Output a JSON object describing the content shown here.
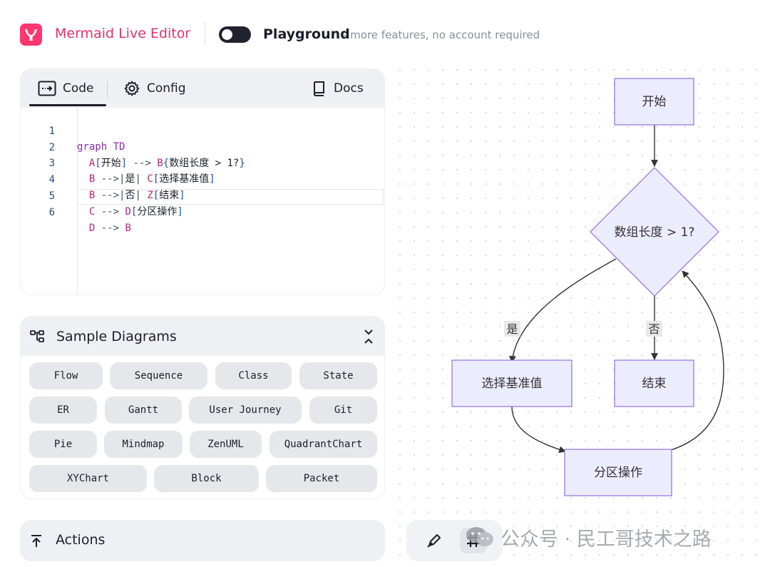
{
  "header": {
    "app_title": "Mermaid Live Editor",
    "mode_label": "Playground",
    "mode_subtitle": "- more features, no account required",
    "toggle_on": false
  },
  "editor": {
    "tabs": [
      {
        "label": "Code",
        "icon": "code-arrow-icon",
        "active": true
      },
      {
        "label": "Config",
        "icon": "gear-icon",
        "active": false
      }
    ],
    "docs_label": "Docs",
    "line_numbers": [
      "1",
      "2",
      "3",
      "4",
      "5",
      "6"
    ],
    "active_line": 6,
    "code": {
      "l1_kw": "graph",
      "l1_dir": "TD",
      "l2_a": "A",
      "l2_a_text": "开始",
      "l2_arrow": "-->",
      "l2_b": "B",
      "l2_b_text": "数组长度 > 1?",
      "l3_b": "B",
      "l3_arrow": "-->|",
      "l3_label": "是",
      "l3_close": "|",
      "l3_c": "C",
      "l3_c_text": "选择基准值",
      "l4_b": "B",
      "l4_arrow": "-->|",
      "l4_label": "否",
      "l4_close": "|",
      "l4_z": "Z",
      "l4_z_text": "结束",
      "l5_c": "C",
      "l5_arrow": "-->",
      "l5_d": "D",
      "l5_d_text": "分区操作",
      "l6_d": "D",
      "l6_arrow": "-->",
      "l6_b": "B"
    }
  },
  "samples": {
    "title": "Sample Diagrams",
    "rows": [
      [
        "Flow",
        "Sequence",
        "Class",
        "State"
      ],
      [
        "ER",
        "Gantt",
        "User Journey",
        "Git"
      ],
      [
        "Pie",
        "Mindmap",
        "ZenUML",
        "QuadrantChart"
      ],
      [
        "XYChart",
        "Block",
        "Packet"
      ]
    ]
  },
  "actions": {
    "label": "Actions"
  },
  "diagram": {
    "nodes": {
      "start": "开始",
      "decision": "数组长度 > 1?",
      "pivot": "选择基准值",
      "end": "结束",
      "partition": "分区操作"
    },
    "edge_labels": {
      "yes": "是",
      "no": "否"
    }
  },
  "watermark": {
    "text": "公众号 · 民工哥技术之路"
  },
  "colors": {
    "brand": "#ff3670",
    "node_fill": "#ececff",
    "node_stroke": "#9370db",
    "edge": "#333333",
    "tab_bg": "#eff0f4",
    "chip_bg": "#e6e7eb"
  }
}
